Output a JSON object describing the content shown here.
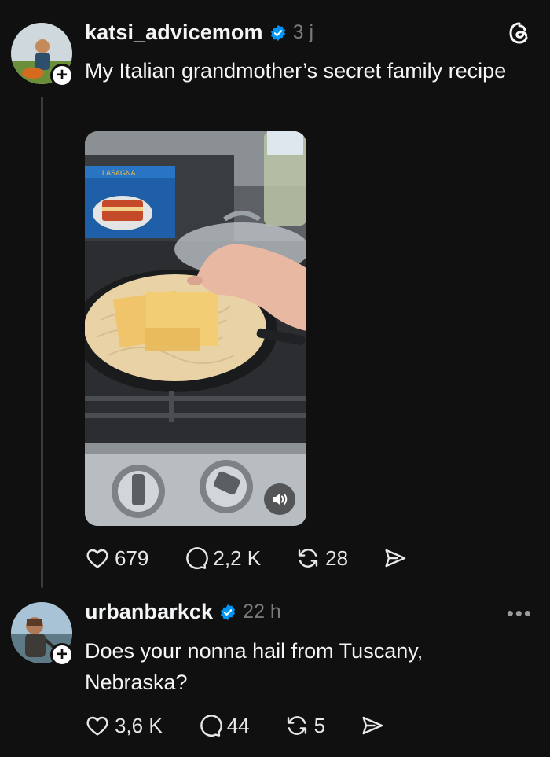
{
  "post": {
    "username": "katsi_advicemom",
    "timestamp": "3 j",
    "text": "My Italian grandmother’s secret family recipe",
    "stats": {
      "likes": "679",
      "replies": "2,2 K",
      "reposts": "28"
    }
  },
  "reply": {
    "username": "urbanbarkck",
    "timestamp": "22 h",
    "text": "Does your nonna hail from Tuscany, Nebraska?",
    "stats": {
      "likes": "3,6 K",
      "replies": "44",
      "reposts": "5"
    },
    "more_label": "•••"
  },
  "media": {
    "box_label_top": "LASAGNA",
    "sound_icon": "speaker-icon"
  },
  "colors": {
    "background": "#101010",
    "verified": "#0095f6",
    "text": "#f3f5f7",
    "muted": "#7a7a7a"
  }
}
